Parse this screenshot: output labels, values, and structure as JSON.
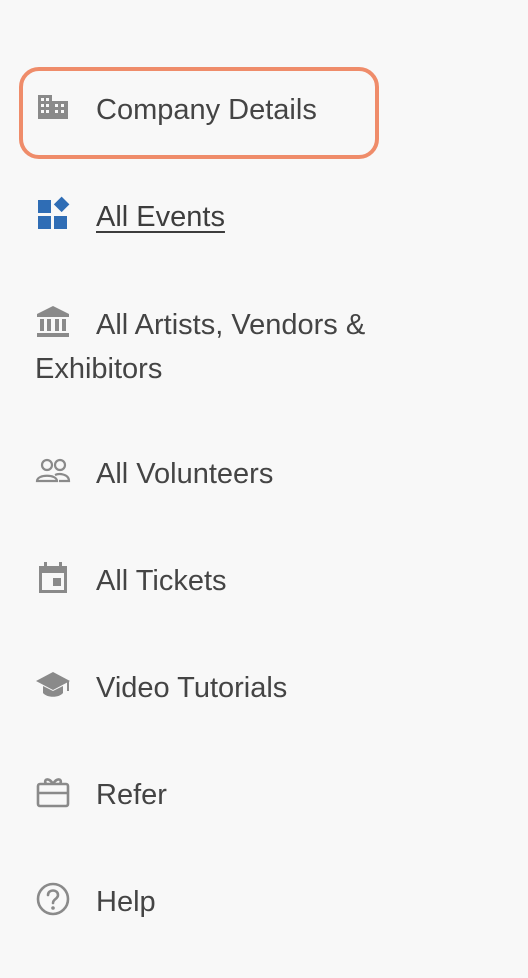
{
  "nav": {
    "items": [
      {
        "label": "Company Details",
        "icon": "building-icon",
        "highlighted": true
      },
      {
        "label": "All Events",
        "icon": "widgets-icon",
        "active": true
      },
      {
        "label": "All Artists, Vendors & Exhibitors",
        "icon": "bank-icon"
      },
      {
        "label": "All Volunteers",
        "icon": "people-icon"
      },
      {
        "label": "All Tickets",
        "icon": "calendar-icon"
      },
      {
        "label": "Video Tutorials",
        "icon": "school-icon"
      },
      {
        "label": "Refer",
        "icon": "gift-card-icon"
      },
      {
        "label": "Help",
        "icon": "help-circle-icon"
      }
    ]
  },
  "colors": {
    "highlight": "#ef8c6a",
    "active_icon": "#2f6db5",
    "icon_gray": "#8a8a8a",
    "text": "#444444",
    "background": "#f8f8f8"
  }
}
